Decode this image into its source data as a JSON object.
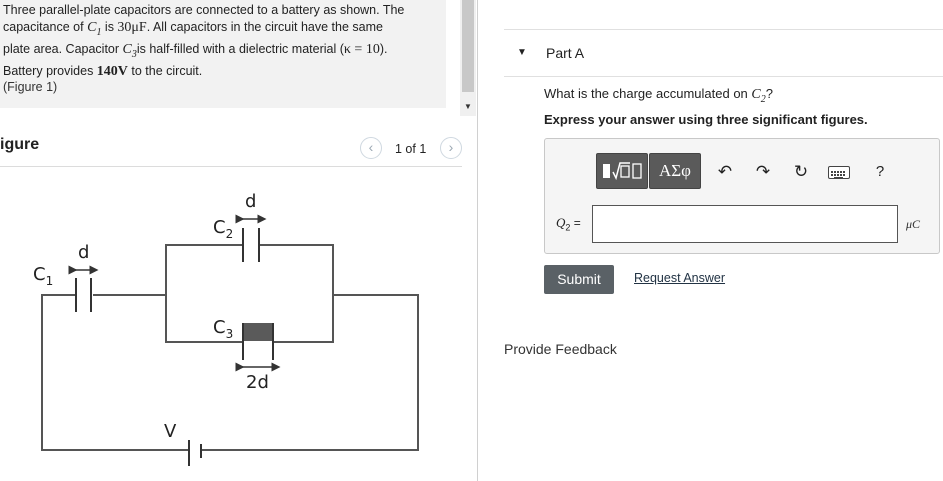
{
  "problem": {
    "line1": "Three parallel-plate capacitors are connected to a battery as shown. The",
    "line2_a": "capacitance of ",
    "line2_c1": "C",
    "line2_c1_sub": "1",
    "line2_b": " is ",
    "line2_val": "30μF",
    "line2_c": ". All capacitors in the circuit have the same",
    "line3_a": "plate area. Capacitor ",
    "line3_c3": "C",
    "line3_c3_sub": "3",
    "line3_b": "is half-filled with a dielectric material (",
    "line3_kappa": "κ = 10",
    "line3_c": ").",
    "line4_a": "Battery provides ",
    "line4_val": "140V",
    "line4_b": " to the circuit.",
    "figure_link": "(Figure 1)"
  },
  "figure": {
    "title": "igure",
    "counter": "1 of 1",
    "prev": "‹",
    "next": "›",
    "labels": {
      "c1": "C",
      "c1_sub": "1",
      "c2": "C",
      "c2_sub": "2",
      "c3": "C",
      "c3_sub": "3",
      "d1": "d",
      "d2": "d",
      "d3": "2d",
      "v": "V"
    }
  },
  "part": {
    "title": "Part A",
    "question_a": "What is the charge accumulated on ",
    "question_var": "C",
    "question_sub": "2",
    "question_b": "?",
    "instruction": "Express your answer using three significant figures.",
    "greek_label": "ΑΣφ",
    "help_label": "?",
    "var_label": "Q",
    "var_sub": "2",
    "var_eq": " =",
    "answer_value": "",
    "unit": "μC",
    "submit_label": "Submit",
    "request_label": "Request Answer"
  },
  "feedback_label": "Provide Feedback"
}
